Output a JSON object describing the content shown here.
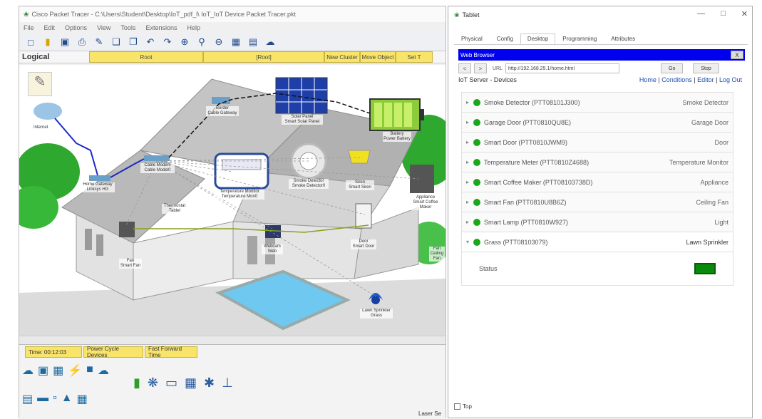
{
  "main": {
    "title": "Cisco Packet Tracer - C:\\Users\\Student\\Desktop\\IoT_pdf_l\\ IoT_IoT Device Packet Tracer.pkt",
    "menu": [
      "File",
      "Edit",
      "Options",
      "View",
      "Tools",
      "Extensions",
      "Help"
    ],
    "toolbar_icons": [
      "new-icon",
      "open-icon",
      "save-icon",
      "print-icon",
      "activity-wizard-icon",
      "copy-icon",
      "paste-icon",
      "undo-icon",
      "redo-icon",
      "zoom-in-icon",
      "zoom-reset-icon",
      "zoom-out-icon",
      "palette-icon",
      "custom-device-icon",
      "network-info-icon"
    ],
    "logical_label": "Logical",
    "logical_bar": [
      "Root",
      "[Root]",
      "New Cluster",
      "Move Object",
      "Set T"
    ],
    "bottom_tabs": [
      "Time: 00:12:03",
      "Power Cycle Devices",
      "Fast Forward Time"
    ],
    "realtime_label": "Laser Se"
  },
  "scene_labels": [
    {
      "text": "Internet"
    },
    {
      "text": "Cable Modem\nCable Model0"
    },
    {
      "text": "Home Gateway\nLinksys HG"
    },
    {
      "text": "Border\nCable Gateway"
    },
    {
      "text": "Solar Panel\nSmart Solar Panel"
    },
    {
      "text": "Battery\nPower Battery"
    },
    {
      "text": "Temperature Monitor\nTemperature Mon0"
    },
    {
      "text": "Smoke Detector\nSmoke Detector0"
    },
    {
      "text": "Fan\nSmart Fan"
    },
    {
      "text": "Appliance\nSmart Coffee Maker"
    },
    {
      "text": "Thermostat\nTablet"
    },
    {
      "text": "Door\nSmart Door"
    },
    {
      "text": "Siren\nSmart Siren"
    },
    {
      "text": "Webcam\nWeb"
    },
    {
      "text": "Lawn Sprinkler\nGrass"
    },
    {
      "text": "Fan\nCeiling Fan"
    }
  ],
  "tablet": {
    "title": "Tablet",
    "tabs": [
      "Physical",
      "Config",
      "Desktop",
      "Programming",
      "Attributes"
    ],
    "active_tab": "Desktop",
    "browser_title": "Web Browser",
    "browser_close": "X",
    "nav_back": "<",
    "nav_fwd": ">",
    "url_label": "URL",
    "url": "http://192.168.25.1/home.html",
    "go_label": "Go",
    "stop_label": "Stop",
    "server_title": "IoT Server - Devices",
    "links": [
      "Home",
      "Conditions",
      "Editor",
      "Log Out"
    ],
    "devices": [
      {
        "name": "Smoke Detector (PTT08101J300)",
        "type": "Smoke Detector",
        "expanded": false
      },
      {
        "name": "Garage Door (PTT0810QU8E)",
        "type": "Garage Door",
        "expanded": false
      },
      {
        "name": "Smart Door (PTT0810JWM9)",
        "type": "Door",
        "expanded": false
      },
      {
        "name": "Temperature Meter (PTT0810Z4688)",
        "type": "Temperature Monitor",
        "expanded": false
      },
      {
        "name": "Smart Coffee Maker (PTT08103738D)",
        "type": "Appliance",
        "expanded": false
      },
      {
        "name": "Smart Fan (PTT0810U8B6Z)",
        "type": "Ceiling Fan",
        "expanded": false
      },
      {
        "name": "Smart Lamp (PTT0810W927)",
        "type": "Light",
        "expanded": false
      },
      {
        "name": "Grass (PTT08103079)",
        "type": "Lawn Sprinkler",
        "expanded": true
      }
    ],
    "status_label": "Status",
    "status_color": "#0a8a0a",
    "top_label": "Top"
  }
}
